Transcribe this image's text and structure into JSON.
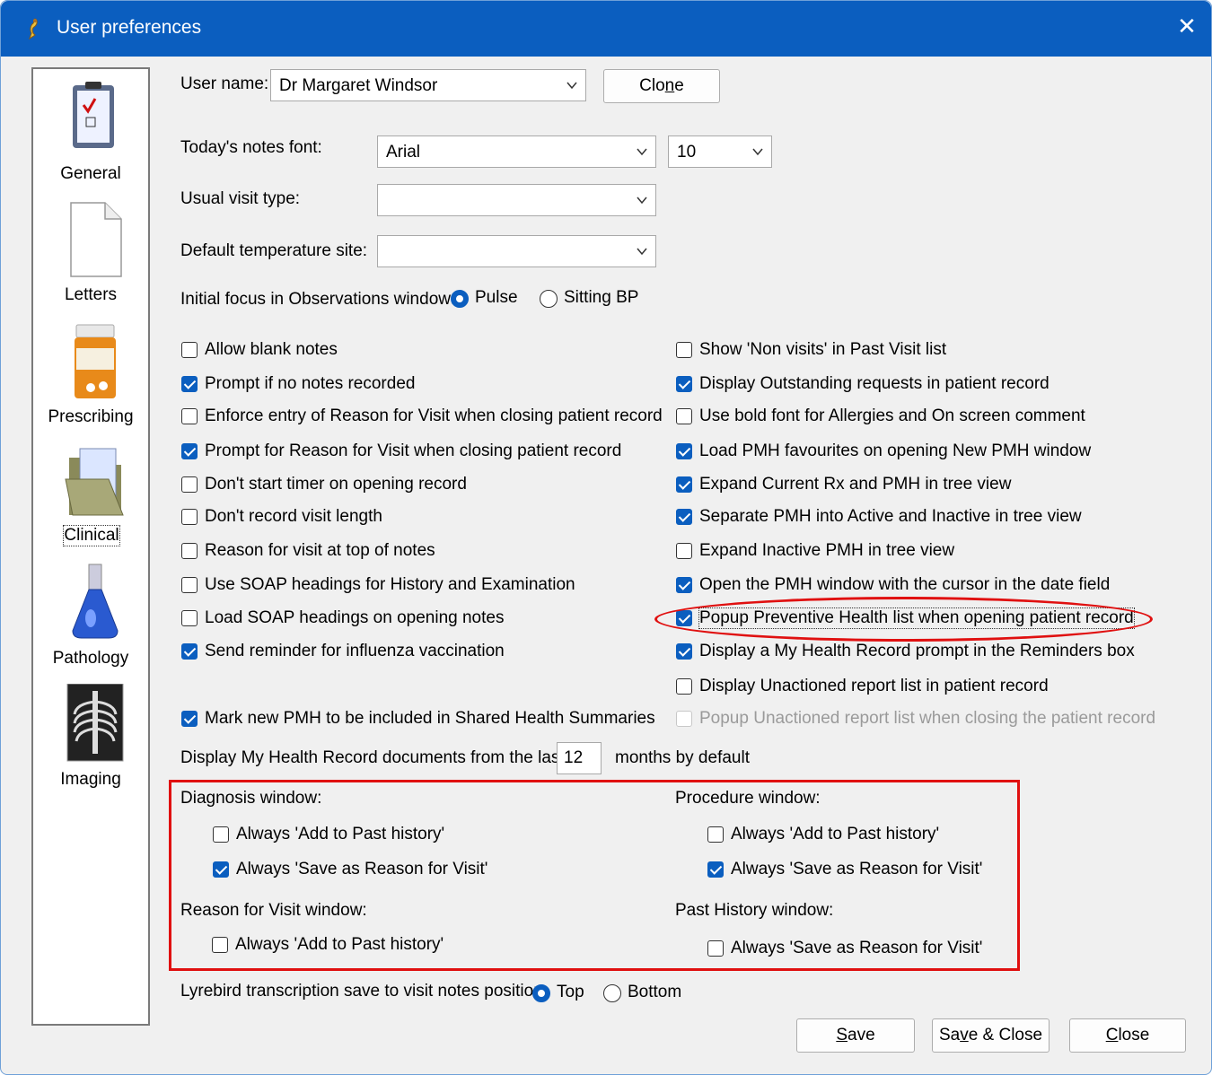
{
  "window": {
    "title": "User preferences",
    "close_glyph": "✕",
    "icon": "lyrebird-icon"
  },
  "sidebar": {
    "items": [
      {
        "label": "General",
        "icon": "clipboard-checklist-icon",
        "selected": false
      },
      {
        "label": "Letters",
        "icon": "document-icon",
        "selected": false
      },
      {
        "label": "Prescribing",
        "icon": "pill-bottle-icon",
        "selected": false
      },
      {
        "label": "Clinical",
        "icon": "folder-icon",
        "selected": true
      },
      {
        "label": "Pathology",
        "icon": "flask-icon",
        "selected": false
      },
      {
        "label": "Imaging",
        "icon": "xray-icon",
        "selected": false
      }
    ]
  },
  "user": {
    "label": "User name:",
    "value": "Dr Margaret Windsor",
    "clone_pre": "Clo",
    "clone_u": "n",
    "clone_post": "e"
  },
  "font": {
    "label": "Today's notes font:",
    "value": "Arial",
    "size": "10"
  },
  "visit_type": {
    "label": "Usual visit type:",
    "value": ""
  },
  "temp_site": {
    "label": "Default temperature site:",
    "value": ""
  },
  "focus": {
    "label": "Initial focus in Observations window:",
    "options": [
      "Pulse",
      "Sitting BP"
    ],
    "selected": "Pulse"
  },
  "left_checks": [
    {
      "label": "Allow blank notes",
      "checked": false
    },
    {
      "label": "Prompt if no notes recorded",
      "checked": true
    },
    {
      "label": "Enforce entry of Reason for Visit when closing patient record",
      "checked": false
    },
    {
      "label": "Prompt for Reason for Visit when closing patient record",
      "checked": true
    },
    {
      "label": "Don't start timer on opening record",
      "checked": false
    },
    {
      "label": "Don't record visit length",
      "checked": false
    },
    {
      "label": "Reason for visit at top of notes",
      "checked": false
    },
    {
      "label": "Use SOAP headings for History and Examination",
      "checked": false
    },
    {
      "label": "Load SOAP headings on opening notes",
      "checked": false
    },
    {
      "label": "Send reminder for influenza vaccination",
      "checked": true
    }
  ],
  "right_checks": [
    {
      "label": "Show 'Non visits' in Past Visit list",
      "checked": false
    },
    {
      "label": "Display Outstanding requests in patient record",
      "checked": true
    },
    {
      "label": "Use bold font for Allergies and On screen comment",
      "checked": false
    },
    {
      "label": "Load PMH favourites on opening New PMH window",
      "checked": true
    },
    {
      "label": "Expand Current Rx and PMH in tree view",
      "checked": true
    },
    {
      "label": "Separate PMH into Active and Inactive in tree view",
      "checked": true
    },
    {
      "label": "Expand Inactive PMH in tree view",
      "checked": false
    },
    {
      "label": "Open the PMH window with the cursor in the date field",
      "checked": true
    },
    {
      "label": "Popup Preventive Health list when opening patient record",
      "checked": true
    },
    {
      "label": "Display a My Health Record prompt in the Reminders box",
      "checked": true
    },
    {
      "label": "Display Unactioned report list in patient record",
      "checked": false
    },
    {
      "label": "Popup Unactioned report list when closing the patient record",
      "checked": false,
      "disabled": true
    }
  ],
  "shared_summary": {
    "label": "Mark new PMH to be included in Shared Health Summaries",
    "checked": true
  },
  "mhr_docs": {
    "label": "Display My Health Record documents from the last:",
    "value": "12",
    "suffix": "months by default"
  },
  "diagnosis": {
    "label": "Diagnosis window:",
    "add_past": {
      "label": "Always 'Add to Past history'",
      "checked": false
    },
    "save_reason": {
      "label": "Always 'Save as Reason for Visit'",
      "checked": true
    }
  },
  "procedure": {
    "label": "Procedure window:",
    "add_past": {
      "label": "Always 'Add to Past history'",
      "checked": false
    },
    "save_reason": {
      "label": "Always 'Save as Reason for Visit'",
      "checked": true
    }
  },
  "reason_window": {
    "label": "Reason for Visit window:",
    "add_past": {
      "label": "Always 'Add to Past history'",
      "checked": false
    }
  },
  "past_history_window": {
    "label": "Past History window:",
    "save_reason": {
      "label": "Always 'Save as Reason for Visit'",
      "checked": false
    }
  },
  "lyrebird": {
    "label": "Lyrebird transcription save to visit notes position:",
    "options": [
      "Top",
      "Bottom"
    ],
    "selected": "Top"
  },
  "buttons": {
    "save": {
      "u": "S",
      "rest": "ave"
    },
    "save_close": {
      "pre": "Sa",
      "u": "v",
      "rest": "e & Close"
    },
    "close": {
      "u": "C",
      "rest": "lose"
    }
  },
  "colors": {
    "titlebar": "#0b5ebf",
    "checked": "#0b5ebf",
    "highlight": "#e01010"
  }
}
